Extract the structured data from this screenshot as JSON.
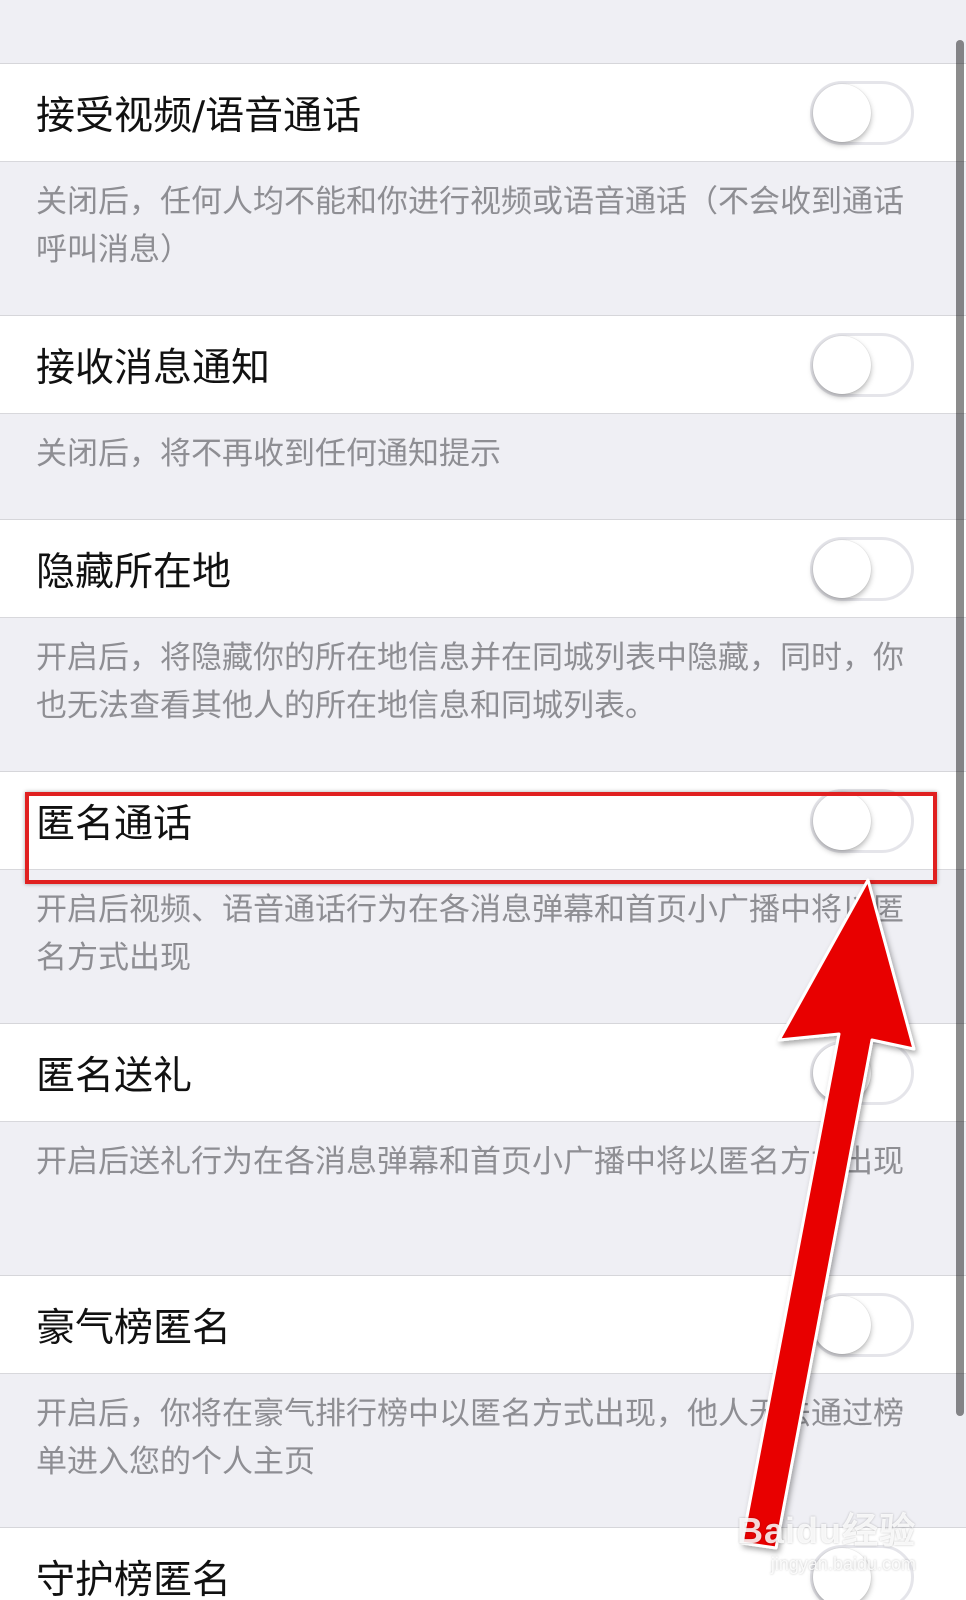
{
  "settings": [
    {
      "label": "接受视频/语音通话",
      "enabled": false,
      "description": "关闭后，任何人均不能和你进行视频或语音通话（不会收到通话呼叫消息）"
    },
    {
      "label": "接收消息通知",
      "enabled": false,
      "description": "关闭后，将不再收到任何通知提示"
    },
    {
      "label": "隐藏所在地",
      "enabled": false,
      "description": "开启后，将隐藏你的所在地信息并在同城列表中隐藏，同时，你也无法查看其他人的所在地信息和同城列表。"
    },
    {
      "label": "匿名通话",
      "enabled": false,
      "description": "开启后视频、语音通话行为在各消息弹幕和首页小广播中将以匿名方式出现"
    },
    {
      "label": "匿名送礼",
      "enabled": false,
      "description": "开启后送礼行为在各消息弹幕和首页小广播中将以匿名方式出现"
    },
    {
      "label": "豪气榜匿名",
      "enabled": false,
      "description": "开启后，你将在豪气排行榜中以匿名方式出现，他人无法通过榜单进入您的个人主页"
    },
    {
      "label": "守护榜匿名",
      "enabled": false
    }
  ],
  "annotation": {
    "highlight_color": "#e02020",
    "arrow_color": "#e80000"
  },
  "watermark": {
    "main": "Baidu经验",
    "sub": "jingyan.baidu.com"
  }
}
